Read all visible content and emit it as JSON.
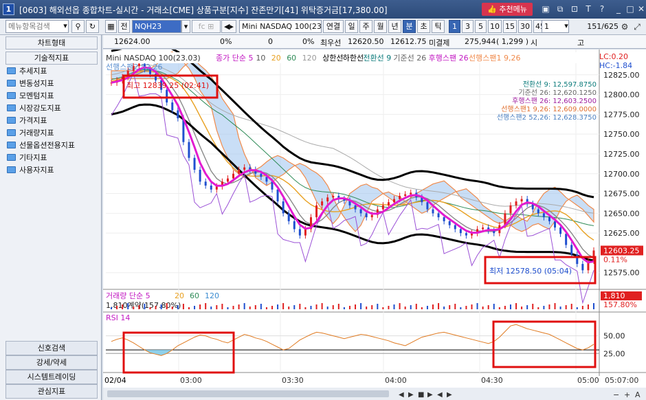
{
  "window": {
    "number": "1",
    "title": "[0603] 해외선옵 종합차트-실시간 - 거래소[CME] 상품구분[지수] 잔존만기[41] 위탁증거금[17,380.00]",
    "recommend_menu": "추천메뉴"
  },
  "toolbar": {
    "menu_search_placeholder": "메뉴항목검색",
    "prev_label": "전",
    "code": "NQH23",
    "product_name": "Mini NASDAQ 100(23.0",
    "period_buttons": [
      "연결",
      "일",
      "주",
      "월",
      "년",
      "분",
      "초",
      "틱"
    ],
    "active_period": "분",
    "interval_buttons": [
      "1",
      "3",
      "5",
      "10",
      "15",
      "30",
      "45",
      "60"
    ],
    "active_interval": "1",
    "interval_value": "1",
    "page_count": "151",
    "page_total": "/625"
  },
  "sidebar": {
    "header_items": [
      "차트형태",
      "기술적지표"
    ],
    "tree": [
      "추세지표",
      "변동성지표",
      "모멘텀지표",
      "시장강도지표",
      "가격지표",
      "거래량지표",
      "선물옵션전용지표",
      "기타지표",
      "사용자지표"
    ],
    "footer_items": [
      "신호검색",
      "강세/약세",
      "시스템트레이딩",
      "관심지표"
    ]
  },
  "info_row": {
    "price": "12624.00",
    "pct1": "0%",
    "val2": "0",
    "pct2": "0%",
    "best_bid_label": "최우선",
    "best_bid": "12620.50",
    "best_ask": "12612.75",
    "contract_label": "미결제",
    "open_interest": "275,944",
    "oi_change": "( 1,299 )",
    "h_label": "시",
    "g_label": "고"
  },
  "chart_data": {
    "type": "line",
    "product": "Mini NASDAQ 100(23.03)",
    "legend_line1": [
      "종가 단순 5",
      "10",
      "20",
      "60",
      "120",
      "상한선",
      "하한선",
      "전환선 9",
      "기준선 26",
      "후행스팬 26",
      "선행스팬1 9,26"
    ],
    "legend_line2": "선행스팬2 52,26",
    "lc": "LC:0.20",
    "hc": "HC:-1.84",
    "ichimoku_box": [
      "전환선 9: 12,597.8750",
      "기준선 26: 12,620.1250",
      "후행스팬 26: 12,603.2500",
      "선행스팬1 9,26: 12,609.0000",
      "선행스팬2 52,26: 12,628.3750"
    ],
    "high_label": "최고 12839.25 (02:41)",
    "low_label": "최저 12578.50 (05:04)",
    "current_price": "12603.25",
    "current_pct": "0.11%",
    "y_ticks": [
      "12825.00",
      "12800.00",
      "12775.00",
      "12750.00",
      "12725.00",
      "12700.00",
      "12675.00",
      "12650.00",
      "12625.00",
      "12575.00"
    ],
    "ylim": [
      12560,
      12850
    ],
    "volume_panel": {
      "title": "거래량 단순 5",
      "ma_labels": [
        "20",
        "60",
        "120"
      ],
      "sub": "1,810계약(157.80%)",
      "right_value": "1,810",
      "right_pct": "157.80%"
    },
    "rsi_panel": {
      "title": "RSI 14",
      "y_ticks": [
        "50.00",
        "25.00"
      ]
    },
    "x_ticks": [
      "02/04",
      "03:00",
      "03:30",
      "04:00",
      "04:30",
      "05:00",
      "05:07:00"
    ],
    "price_series": [
      12815,
      12818,
      12822,
      12830,
      12836,
      12839,
      12832,
      12826,
      12818,
      12806,
      12790,
      12780,
      12770,
      12740,
      12720,
      12705,
      12690,
      12685,
      12680,
      12684,
      12690,
      12694,
      12700,
      12705,
      12708,
      12705,
      12700,
      12696,
      12690,
      12680,
      12665,
      12650,
      12640,
      12630,
      12622,
      12630,
      12645,
      12660,
      12665,
      12670,
      12672,
      12668,
      12666,
      12660,
      12655,
      12650,
      12645,
      12648,
      12655,
      12660,
      12664,
      12668,
      12672,
      12674,
      12676,
      12670,
      12664,
      12655,
      12650,
      12645,
      12640,
      12635,
      12630,
      12625,
      12622,
      12625,
      12630,
      12632,
      12628,
      12625,
      12635,
      12650,
      12660,
      12665,
      12668,
      12662,
      12655,
      12650,
      12645,
      12640,
      12632,
      12624,
      12610,
      12598,
      12586,
      12578,
      12590,
      12603
    ],
    "rsi_series": [
      42,
      45,
      47,
      44,
      40,
      35,
      30,
      26,
      24,
      22,
      25,
      30,
      36,
      40,
      44,
      48,
      51,
      50,
      47,
      45,
      42,
      40,
      44,
      48,
      52,
      50,
      47,
      45,
      42,
      38,
      34,
      30,
      32,
      38,
      44,
      48,
      52,
      55,
      54,
      52,
      50,
      48,
      46,
      48,
      50,
      52,
      51,
      49,
      47,
      45,
      43,
      40,
      38,
      36,
      40,
      44,
      48,
      50,
      52,
      54,
      55,
      53,
      51,
      49,
      47,
      45,
      43,
      41,
      39,
      42,
      48,
      56,
      64,
      66,
      63,
      60,
      58,
      56,
      54,
      52,
      48,
      44,
      40,
      36,
      32,
      30,
      33,
      38
    ]
  }
}
